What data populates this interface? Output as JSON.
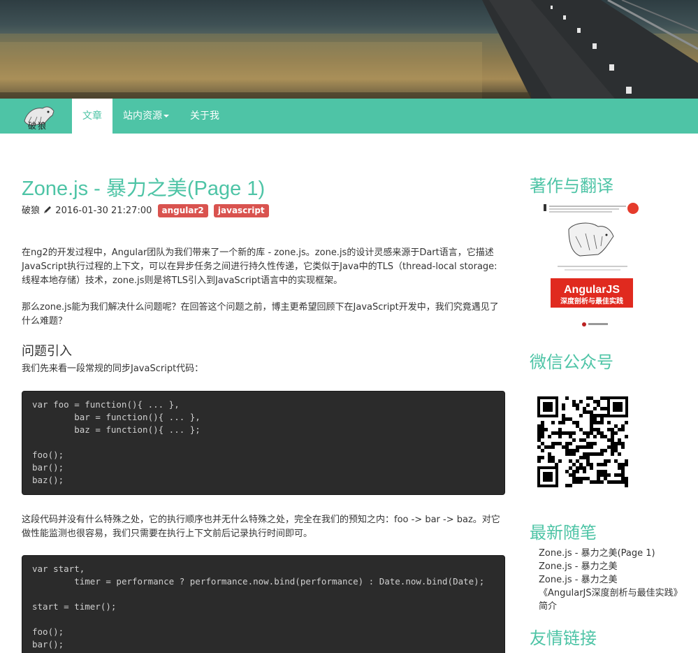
{
  "nav": {
    "brand_text": "破狼",
    "items": [
      {
        "label": "文章"
      },
      {
        "label": "站内资源"
      },
      {
        "label": "关于我"
      }
    ]
  },
  "post": {
    "title": "Zone.js - 暴力之美(Page 1)",
    "author": "破狼",
    "date": "2016-01-30 21:27:00",
    "tags": [
      "angular2",
      "javascript"
    ],
    "p1": "在ng2的开发过程中，Angular团队为我们带来了一个新的库 - zone.js。zone.js的设计灵感来源于Dart语言，它描述JavaScript执行过程的上下文，可以在异步任务之间进行持久性传递，它类似于Java中的TLS（thread-local storage: 线程本地存储）技术，zone.js则是将TLS引入到JavaScript语言中的实现框架。",
    "p2": "那么zone.js能为我们解决什么问题呢？在回答这个问题之前，博主更希望回顾下在JavaScript开发中，我们究竟遇见了什么难题？",
    "h_intro": "问题引入",
    "p3": "我们先来看一段常规的同步JavaScript代码：",
    "code1": "var foo = function(){ ... },\n        bar = function(){ ... },\n        baz = function(){ ... };\n\nfoo();\nbar();\nbaz();",
    "p4": "这段代码并没有什么特殊之处，它的执行顺序也并无什么特殊之处，完全在我们的预知之内：foo -> bar -> baz。对它做性能监测也很容易，我们只需要在执行上下文前后记录执行时间即可。",
    "code2": "var start,\n        timer = performance ? performance.now.bind(performance) : Date.now.bind(Date);\n\nstart = timer();\n\nfoo();\nbar();"
  },
  "sidebar": {
    "books_heading": "著作与翻译",
    "book": {
      "title": "AngularJS",
      "subtitle": "深度剖析与最佳实践"
    },
    "wechat_heading": "微信公众号",
    "recent_heading": "最新随笔",
    "recent": [
      "Zone.js - 暴力之美(Page 1)",
      "Zone.js - 暴力之美",
      "Zone.js - 暴力之美",
      "《AngularJS深度剖析与最佳实践》简介"
    ],
    "links_heading": "友情链接"
  },
  "colors": {
    "accent": "#4ec4a6",
    "tag": "#d9534f",
    "code_bg": "#2b2b2b"
  }
}
